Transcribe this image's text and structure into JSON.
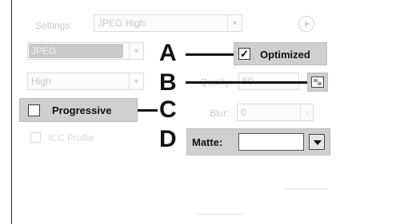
{
  "settings": {
    "label": "Settings:",
    "preset": "JPEG High",
    "format": "JPEG",
    "quality_level": "High",
    "quality_label": "Quality:",
    "quality_value": "60",
    "blur_label": "Blur:",
    "blur_value": "0",
    "extra_option": "ICC Profile"
  },
  "callouts": {
    "a": "A",
    "b": "B",
    "c": "C",
    "d": "D"
  },
  "controls": {
    "optimized_label": "Optimized",
    "optimized_checked": true,
    "progressive_label": "Progressive",
    "progressive_checked": false,
    "matte_label": "Matte:",
    "matte_value": ""
  },
  "icons": {
    "info": "play-circle-icon",
    "quality_picker": "quality-picker-icon",
    "matte_dropdown": "chevron-down-icon"
  }
}
